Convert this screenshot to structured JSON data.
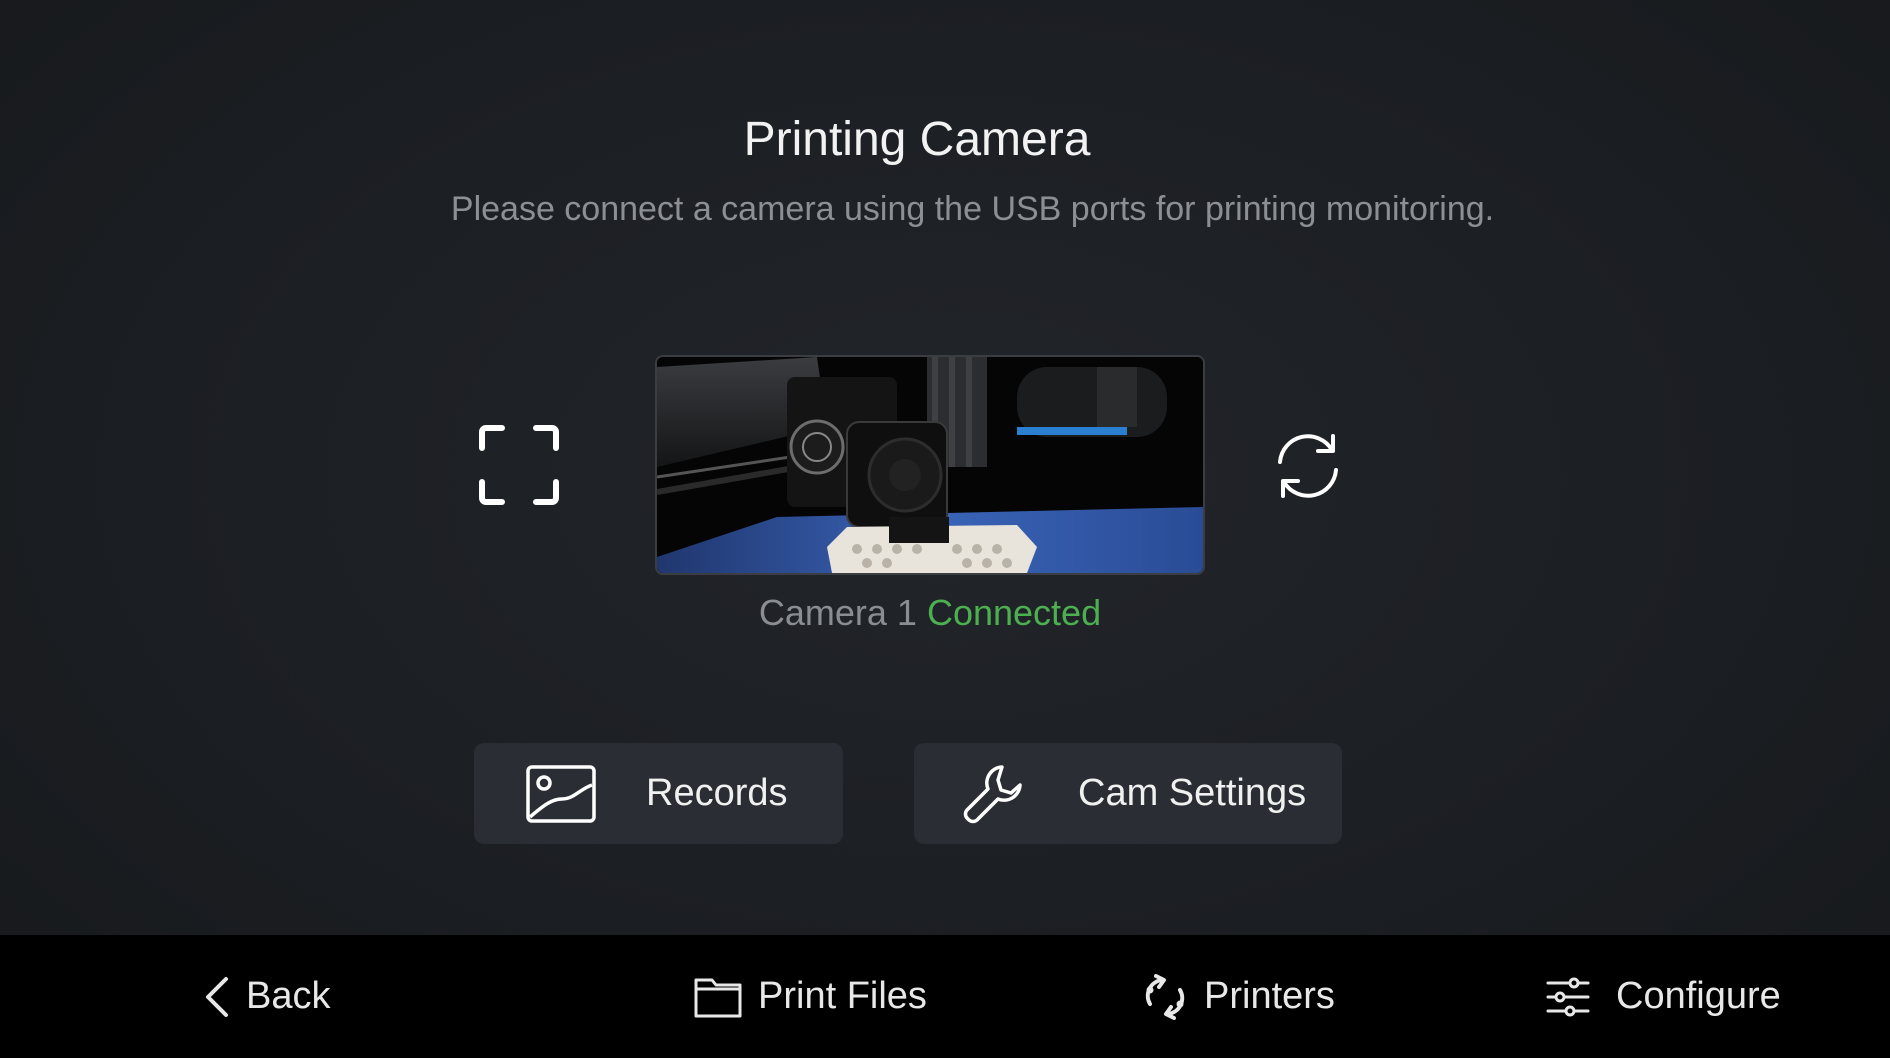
{
  "page": {
    "title": "Printing Camera",
    "subtitle": "Please connect a camera using the USB ports for printing monitoring."
  },
  "camera": {
    "name": "Camera 1",
    "status": "Connected",
    "status_color": "#4caf50",
    "fullscreen_icon": "fullscreen-icon",
    "refresh_icon": "refresh-icon"
  },
  "actions": {
    "records_label": "Records",
    "records_icon": "image-icon",
    "settings_label": "Cam Settings",
    "settings_icon": "wrench-icon"
  },
  "nav": {
    "back_label": "Back",
    "files_label": "Print Files",
    "printers_label": "Printers",
    "configure_label": "Configure"
  },
  "colors": {
    "background": "#1b1e22",
    "button_bg": "#2a2e34",
    "nav_bg": "#000000",
    "accent_green": "#4caf50"
  }
}
